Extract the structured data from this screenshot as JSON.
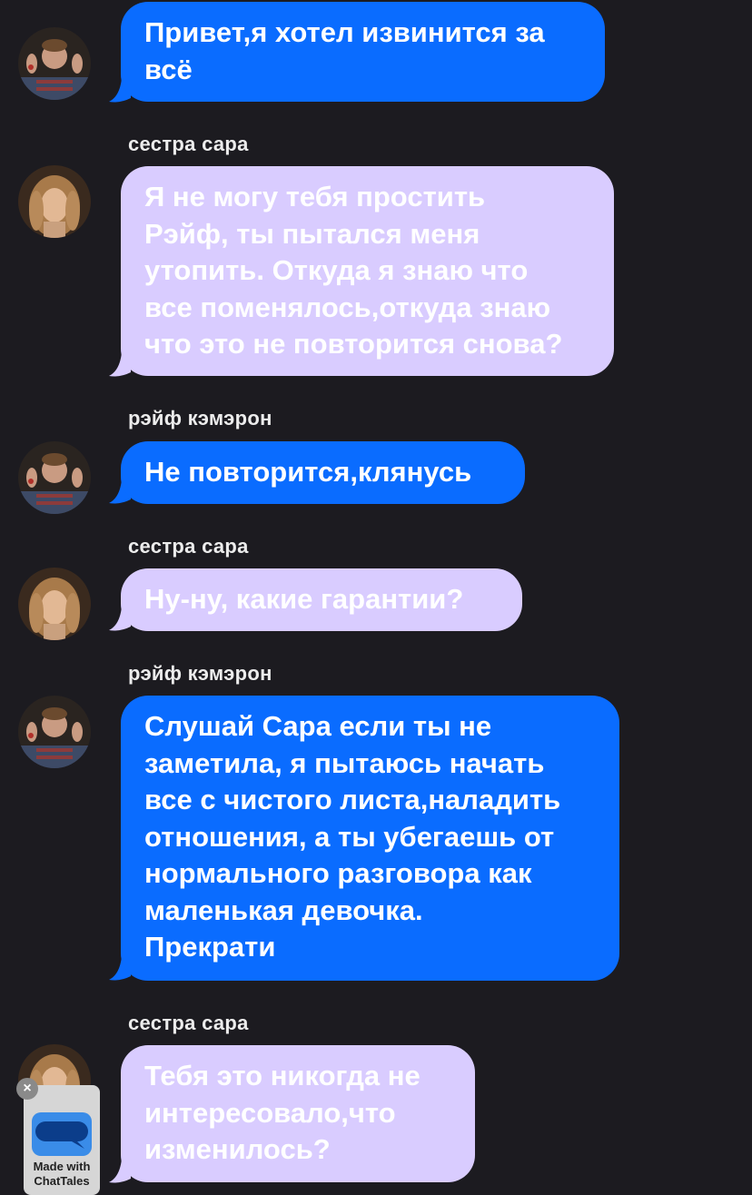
{
  "colors": {
    "background": "#1c1b20",
    "blue_bubble": "#0a6cff",
    "lavender_bubble": "#d9ccff",
    "bubble_text": "#ffffff",
    "sender_text": "#ececec"
  },
  "messages": [
    {
      "sender": "",
      "avatar": "rafe-avatar",
      "style": "blue",
      "text": "Привет,я хотел извинится за\nвсё"
    },
    {
      "sender": "сестра сара",
      "avatar": "sarah-avatar",
      "style": "lavender",
      "text": "Я не могу тебя простить\nРэйф, ты пытался меня\nутопить. Откуда я знаю что\nвсе поменялось,откуда знаю\nчто это не повторится снова?"
    },
    {
      "sender": "рэйф кэмэрон",
      "avatar": "rafe-avatar",
      "style": "blue",
      "text": "Не повторится,клянусь"
    },
    {
      "sender": "сестра сара",
      "avatar": "sarah-avatar",
      "style": "lavender",
      "text": "Ну-ну, какие гарантии?"
    },
    {
      "sender": "рэйф кэмэрон",
      "avatar": "rafe-avatar",
      "style": "blue",
      "text": "Слушай Сара если ты не\nзаметила, я пытаюсь начать\nвсе с чистого листа,наладить\nотношения, а ты убегаешь от\nнормального разговора как\nмаленькая девочка.\nПрекрати"
    },
    {
      "sender": "сестра сара",
      "avatar": "sarah-avatar",
      "style": "lavender",
      "text": "Тебя это никогда не\nинтересовало,что\nизменилось?"
    }
  ],
  "badge": {
    "line1": "Made with",
    "line2": "ChatTales",
    "close_label": "×",
    "icon": "chat-bubble-icon"
  }
}
